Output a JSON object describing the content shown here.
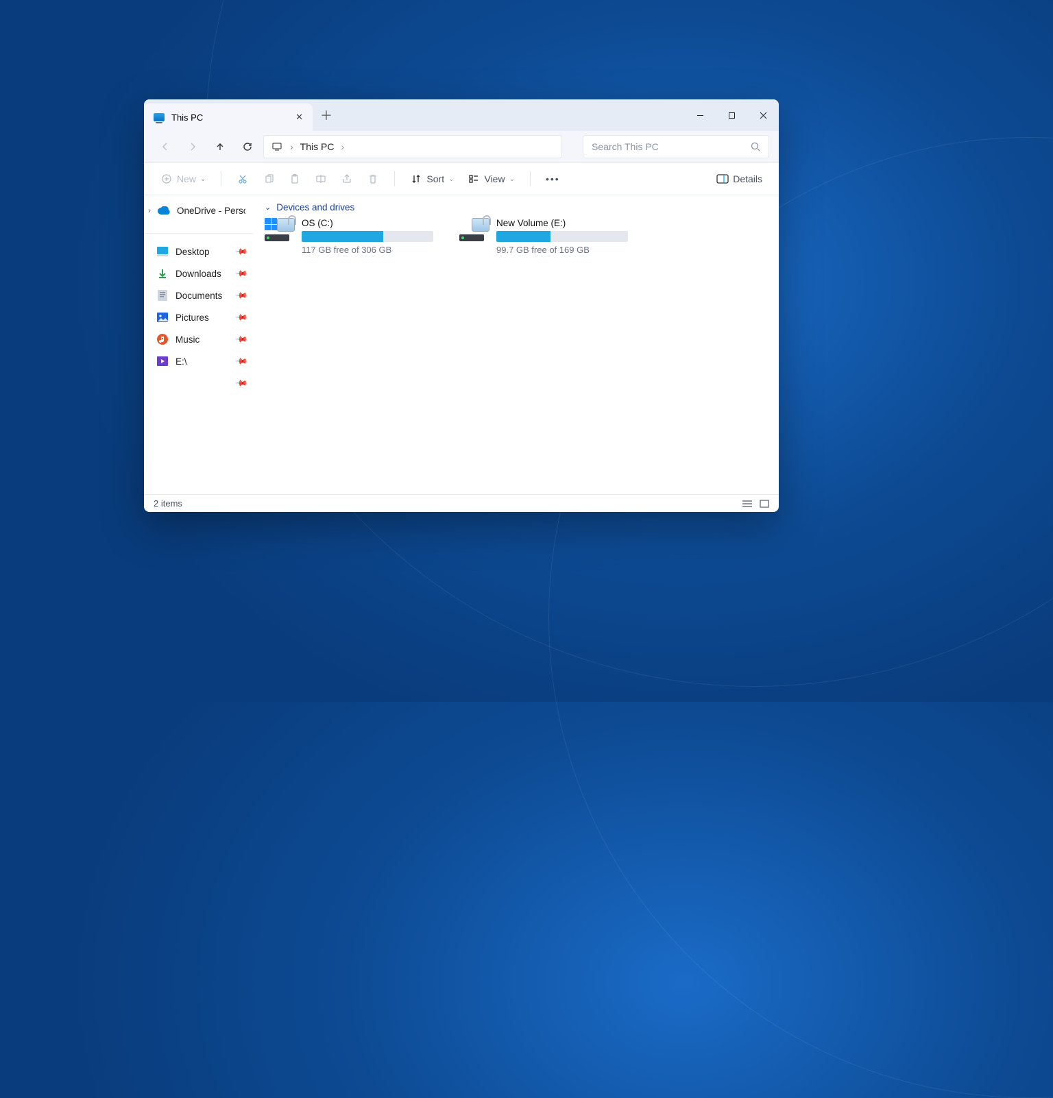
{
  "tab": {
    "title": "This PC"
  },
  "breadcrumb": {
    "location": "This PC"
  },
  "search": {
    "placeholder": "Search This PC"
  },
  "toolbar": {
    "new": "New",
    "sort": "Sort",
    "view": "View",
    "details": "Details"
  },
  "sidebar": {
    "top": "OneDrive - Perso",
    "items": [
      {
        "label": "Desktop"
      },
      {
        "label": "Downloads"
      },
      {
        "label": "Documents"
      },
      {
        "label": "Pictures"
      },
      {
        "label": "Music"
      },
      {
        "label": "E:\\"
      }
    ]
  },
  "group": {
    "title": "Devices and drives"
  },
  "drives": [
    {
      "name": "OS (C:)",
      "free": "117 GB free of 306 GB",
      "fill_pct": 62,
      "winlogo": true
    },
    {
      "name": "New Volume (E:)",
      "free": "99.7 GB free of 169 GB",
      "fill_pct": 41,
      "winlogo": false
    }
  ],
  "status": {
    "count": "2 items"
  }
}
